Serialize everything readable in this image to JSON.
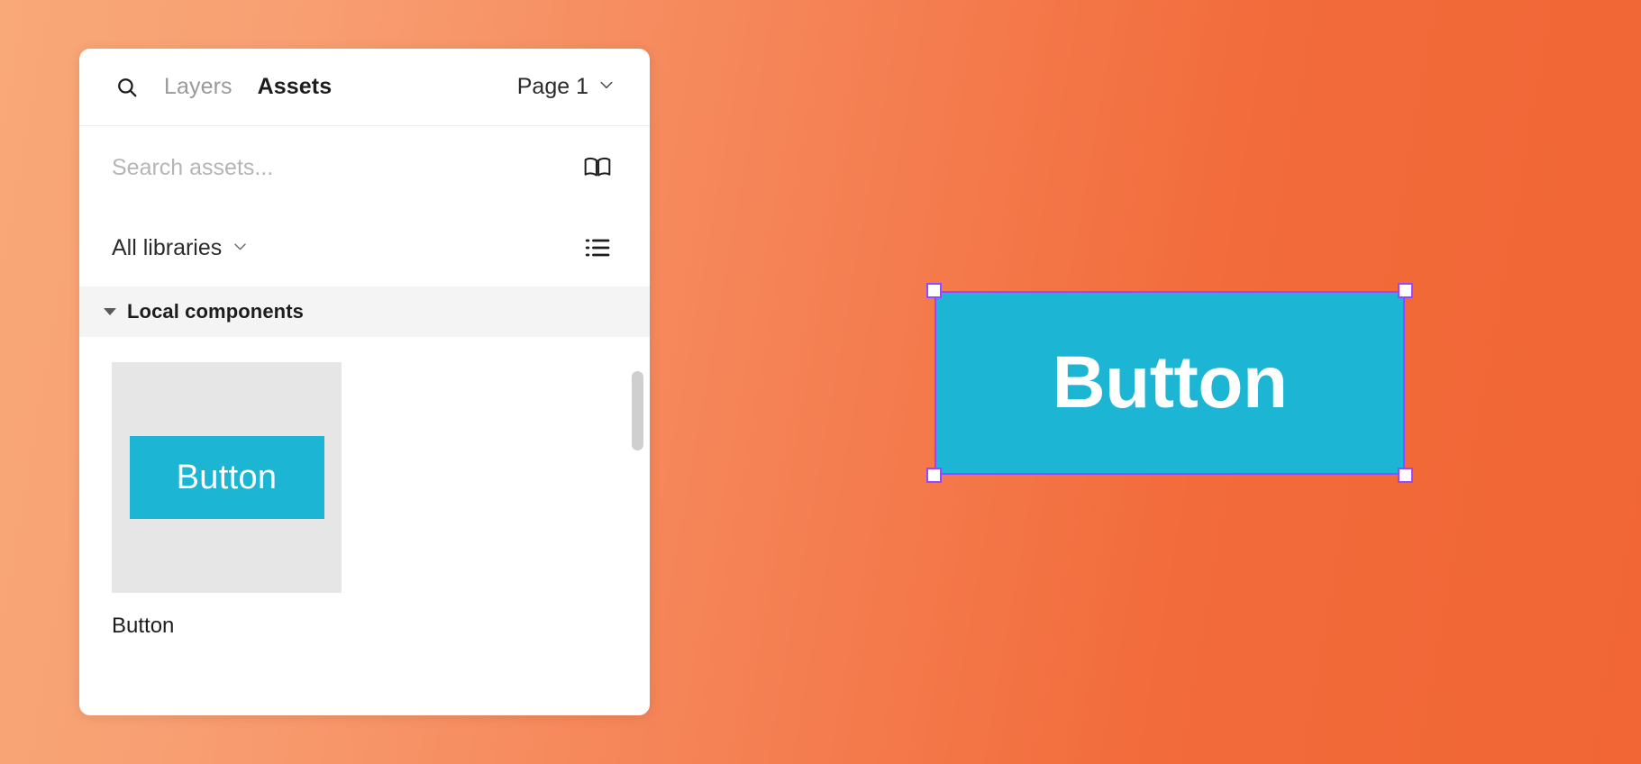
{
  "colors": {
    "canvas_gradient_start": "#f9a877",
    "canvas_gradient_end": "#f16634",
    "component_cyan": "#1cb5d4",
    "selection_purple": "#9747ff",
    "panel_background": "#ffffff",
    "thumb_background": "#e6e6e6",
    "section_band": "#f4f4f4"
  },
  "panel": {
    "header": {
      "search_icon": "search-icon",
      "tabs": [
        {
          "label": "Layers",
          "active": false
        },
        {
          "label": "Assets",
          "active": true
        }
      ],
      "page_selector": {
        "label": "Page 1",
        "chevron_icon": "chevron-down-icon"
      }
    },
    "search": {
      "value": "",
      "placeholder": "Search assets...",
      "library_icon": "book-open-icon"
    },
    "libraries": {
      "label": "All libraries",
      "chevron_icon": "chevron-down-icon",
      "view_icon": "list-view-icon"
    },
    "section": {
      "title": "Local components",
      "expanded": true,
      "disclosure_icon": "triangle-down-icon"
    },
    "assets": [
      {
        "name": "Button",
        "thumbnail_label": "Button"
      }
    ]
  },
  "canvas": {
    "selected_component": {
      "label": "Button",
      "selected": true,
      "handles": [
        "top-left",
        "top-right",
        "bottom-left",
        "bottom-right"
      ]
    }
  }
}
